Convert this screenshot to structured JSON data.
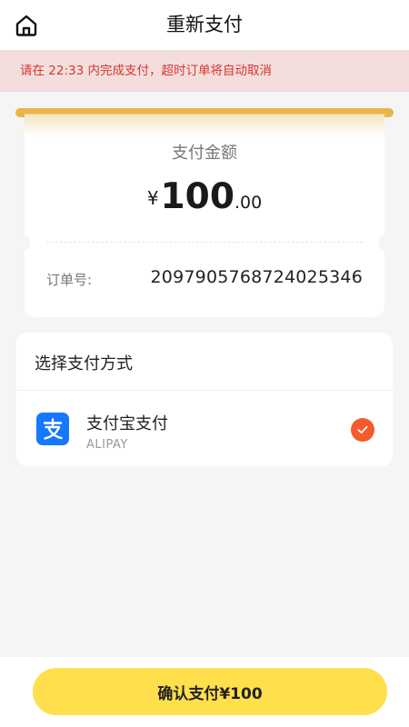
{
  "header": {
    "title": "重新支付",
    "home_icon": "home-icon"
  },
  "notice": {
    "text": "请在 22:33 内完成支付，超时订单将自动取消",
    "color": "#d8352e"
  },
  "receipt": {
    "amount_label": "支付金额",
    "currency": "¥",
    "amount_integer": "100",
    "amount_decimal": ".00",
    "order_label": "订单号:",
    "order_number": "2097905768724025346"
  },
  "payment": {
    "section_title": "选择支付方式",
    "methods": [
      {
        "name": "支付宝支付",
        "subtitle": "ALIPAY",
        "icon": "alipay-icon",
        "selected": true
      }
    ]
  },
  "footer": {
    "confirm_label": "确认支付¥100"
  },
  "colors": {
    "accent_yellow": "#ffdf4c",
    "slot_gold": "#e8b54a",
    "alipay_blue": "#1677ff",
    "check_orange": "#f55a2c",
    "notice_bg": "#f3dedd"
  }
}
